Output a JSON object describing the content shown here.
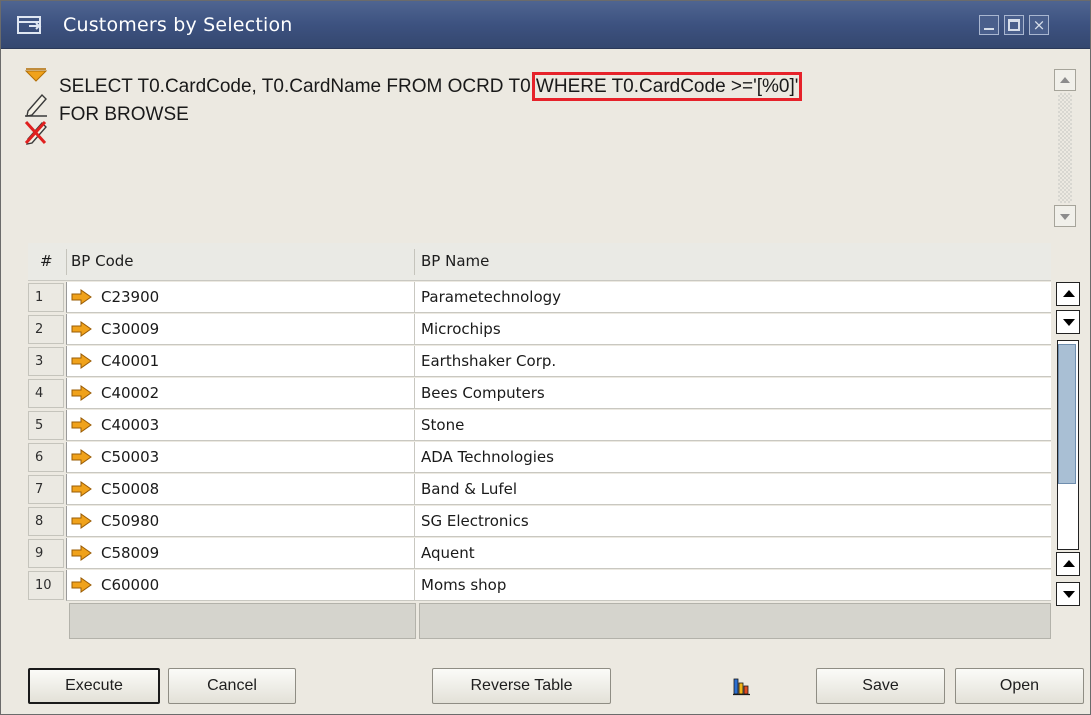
{
  "window": {
    "title": "Customers by Selection",
    "icons": {
      "title_icon": "form-icon",
      "minimize": "minimize-icon",
      "maximize": "maximize-icon",
      "close": "close-icon",
      "close_glyph": "×"
    }
  },
  "query": {
    "prefix": "SELECT T0.CardCode, T0.CardName FROM OCRD T0",
    "highlighted": "WHERE T0.CardCode >='[%0]'",
    "line2": "FOR BROWSE",
    "highlight_color": "#e6222a",
    "side_icons": [
      "dropdown-arrow-icon",
      "edit-pencil-icon",
      "clear-pencil-icon"
    ]
  },
  "grid": {
    "columns": [
      "#",
      "BP Code",
      "BP Name"
    ],
    "rows": [
      {
        "num": "1",
        "code": "C23900",
        "name": "Parametechnology"
      },
      {
        "num": "2",
        "code": "C30009",
        "name": "Microchips"
      },
      {
        "num": "3",
        "code": "C40001",
        "name": "Earthshaker Corp."
      },
      {
        "num": "4",
        "code": "C40002",
        "name": "Bees Computers"
      },
      {
        "num": "5",
        "code": "C40003",
        "name": "Stone"
      },
      {
        "num": "6",
        "code": "C50003",
        "name": "ADA Technologies"
      },
      {
        "num": "7",
        "code": "C50008",
        "name": "Band & Lufel"
      },
      {
        "num": "8",
        "code": "C50980",
        "name": "SG Electronics"
      },
      {
        "num": "9",
        "code": "C58009",
        "name": "Aquent"
      },
      {
        "num": "10",
        "code": "C60000",
        "name": "Moms shop"
      }
    ],
    "link_arrow_color": "#f0a21b"
  },
  "buttons": {
    "execute": "Execute",
    "cancel": "Cancel",
    "reverse_table": "Reverse Table",
    "save": "Save",
    "open": "Open",
    "chart_icon": "chart-icon"
  },
  "colors": {
    "titlebar": "#3d5280",
    "background": "#ece9e1",
    "scroll_thumb": "#a9bfd4"
  }
}
